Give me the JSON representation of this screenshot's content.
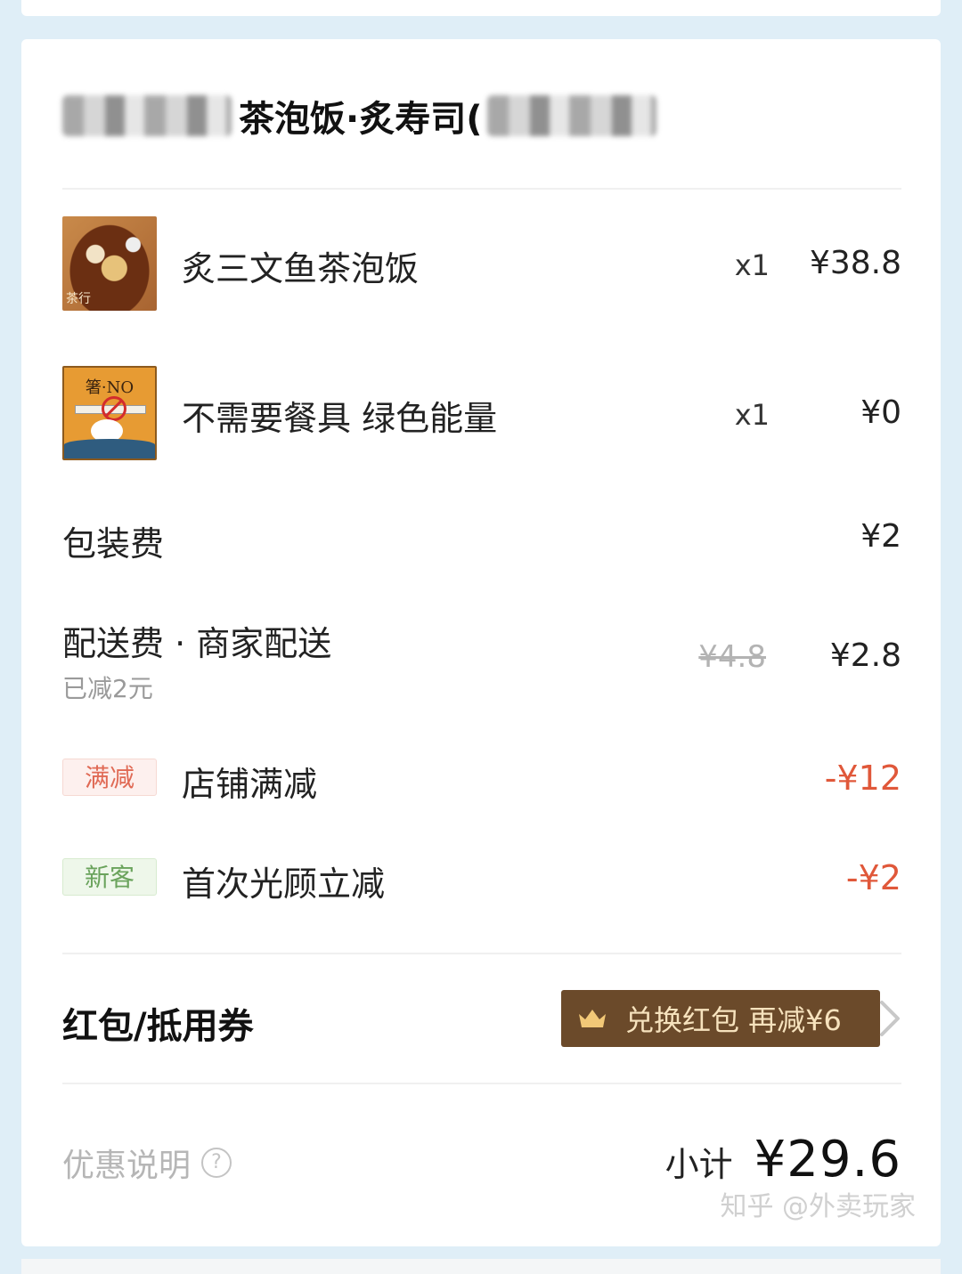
{
  "shop": {
    "title": "茶泡饭·炙寿司("
  },
  "items": [
    {
      "name": "炙三文鱼茶泡饭",
      "qty": "x1",
      "price": "¥38.8",
      "thumb": "food-photo"
    },
    {
      "name": "不需要餐具 绿色能量",
      "qty": "x1",
      "price": "¥0",
      "thumb": "no-cutlery-card",
      "thumb_text": "箸·NO"
    }
  ],
  "fees": {
    "packaging": {
      "label": "包装费",
      "price": "¥2"
    },
    "delivery": {
      "label": "配送费 · 商家配送",
      "note": "已减2元",
      "original": "¥4.8",
      "price": "¥2.8"
    }
  },
  "discounts": [
    {
      "tag": "满减",
      "label": "店铺满减",
      "amount": "-¥12",
      "tag_color": "#e06a55"
    },
    {
      "tag": "新客",
      "label": "首次光顾立减",
      "amount": "-¥2",
      "tag_color": "#6aa35c"
    }
  ],
  "coupon": {
    "title": "红包/抵用券",
    "button": "兑换红包 再减¥6",
    "icon": "crown-icon"
  },
  "summary": {
    "promo_note": "优惠说明",
    "help_icon": "?",
    "subtotal_label": "小计",
    "subtotal_value": "¥29.6"
  },
  "watermark": "知乎 @外卖玩家",
  "colors": {
    "background": "#dfeef7",
    "discount_red": "#e0583a",
    "coupon_button": "#6b4a2a",
    "coupon_text": "#f6e2bd"
  }
}
